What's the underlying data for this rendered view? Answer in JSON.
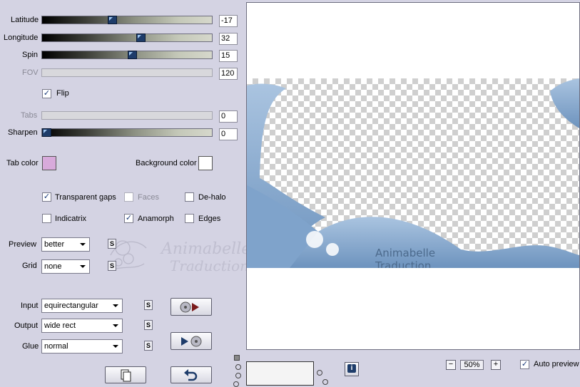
{
  "sliders": [
    {
      "key": "latitude",
      "label": "Latitude",
      "value": "-17",
      "level": 0.41,
      "disabled": false
    },
    {
      "key": "longitude",
      "label": "Longitude",
      "value": "32",
      "level": 0.58,
      "disabled": false
    },
    {
      "key": "spin",
      "label": "Spin",
      "value": "15",
      "level": 0.53,
      "disabled": false
    },
    {
      "key": "fov",
      "label": "FOV",
      "value": "120",
      "level": null,
      "disabled": true
    },
    {
      "key": "tabs",
      "label": "Tabs",
      "value": "0",
      "level": null,
      "disabled": true
    },
    {
      "key": "sharpen",
      "label": "Sharpen",
      "value": "0",
      "level": 0.0,
      "disabled": false
    }
  ],
  "flip": {
    "label": "Flip",
    "checked": true
  },
  "tab_color": {
    "label": "Tab color",
    "color": "#d8aadb"
  },
  "background_color": {
    "label": "Background color",
    "color": "#ffffff"
  },
  "checkboxes": {
    "transparent_gaps": {
      "label": "Transparent gaps",
      "checked": true
    },
    "faces": {
      "label": "Faces",
      "checked": false,
      "disabled": true
    },
    "de_halo": {
      "label": "De-halo",
      "checked": false
    },
    "indicatrix": {
      "label": "Indicatrix",
      "checked": false
    },
    "anamorph": {
      "label": "Anamorph",
      "checked": true
    },
    "edges": {
      "label": "Edges",
      "checked": false
    }
  },
  "preview_select": {
    "label": "Preview",
    "value": "better"
  },
  "grid_select": {
    "label": "Grid",
    "value": "none"
  },
  "input_select": {
    "label": "Input",
    "value": "equirectangular"
  },
  "output_select": {
    "label": "Output",
    "value": "wide rect"
  },
  "glue_select": {
    "label": "Glue",
    "value": "normal"
  },
  "s_button_label": "S",
  "watermark": {
    "line1": "Animabelle",
    "line2": "Traductions"
  },
  "preview_watermark": {
    "line1": "Animabelle",
    "line2": "Traduction"
  },
  "zoom": {
    "minus": "−",
    "value": "50%",
    "plus": "+"
  },
  "auto_preview": {
    "label": "Auto preview",
    "checked": true
  },
  "info_label": "i",
  "colors": {
    "ribbon": "#8fb1d4",
    "ribbon_dark": "#5f86b2",
    "panel_bg": "#d4d3e3"
  }
}
